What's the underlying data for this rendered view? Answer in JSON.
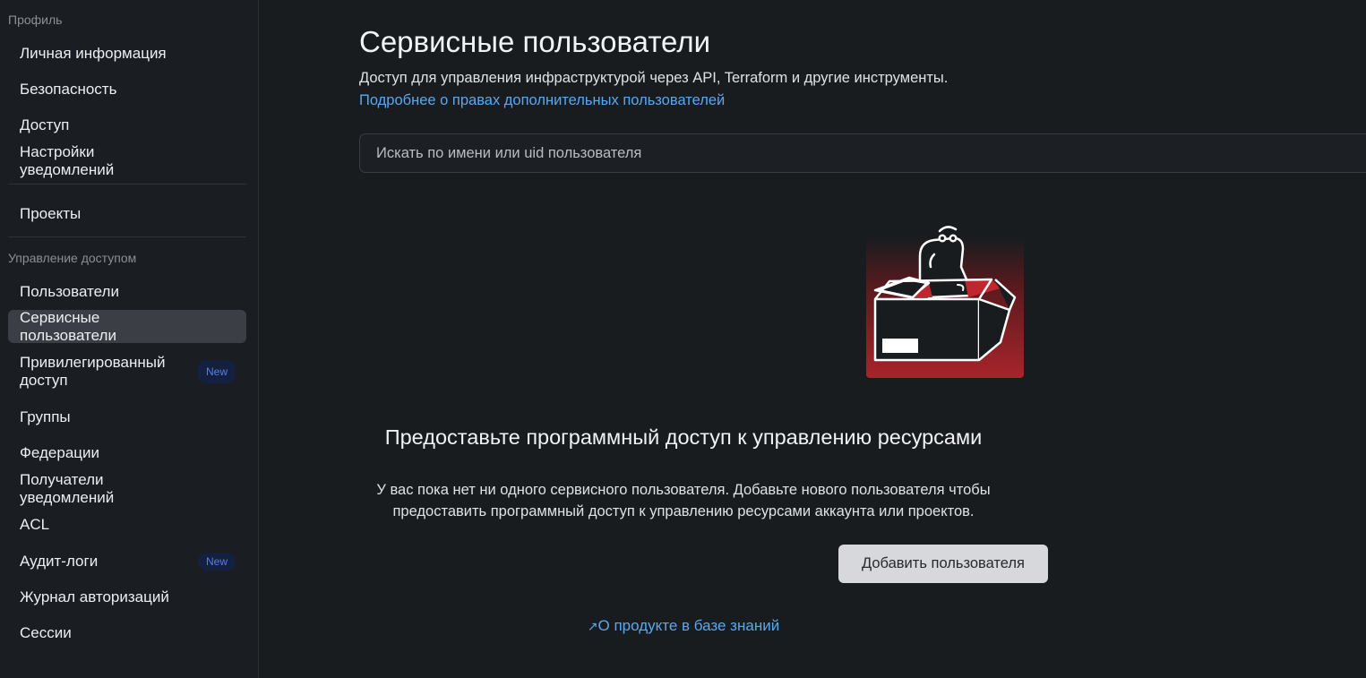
{
  "sidebar": {
    "section_profile": "Профиль",
    "profile_items": [
      {
        "label": "Личная информация"
      },
      {
        "label": "Безопасность"
      },
      {
        "label": "Доступ"
      },
      {
        "label": "Настройки уведомлений"
      }
    ],
    "projects": {
      "label": "Проекты"
    },
    "section_access": "Управление доступом",
    "access_items": [
      {
        "label": "Пользователи"
      },
      {
        "label": "Сервисные пользователи",
        "active": true
      },
      {
        "label": "Привилегированный доступ",
        "badge": "New"
      },
      {
        "label": "Группы"
      },
      {
        "label": "Федерации"
      },
      {
        "label": "Получатели уведомлений"
      },
      {
        "label": "ACL"
      },
      {
        "label": "Аудит-логи",
        "badge": "New"
      },
      {
        "label": "Журнал авторизаций"
      },
      {
        "label": "Сессии"
      }
    ]
  },
  "main": {
    "title": "Сервисные пользователи",
    "subtitle": "Доступ для управления инфраструктурой через API, Terraform и другие инструменты.",
    "more_link": "Подробнее о правах дополнительных пользователей",
    "search": {
      "placeholder": "Искать по имени или uid пользователя",
      "value": ""
    },
    "empty_state": {
      "title": "Предоставьте программный доступ к управлению ресурсами",
      "desc_line1": "У вас пока нет ни одного сервисного пользователя. Добавьте нового пользователя чтобы",
      "desc_line2": "предоставить программный доступ к управлению ресурсами аккаунта или проектов.",
      "button": "Добавить пользователя",
      "kb_arrow": "↗",
      "kb_link": "О продукте в базе знаний",
      "illustration_icon": "dinosaur-in-box-icon"
    }
  },
  "colors": {
    "background": "#191c1f",
    "link": "#5aa7f0",
    "active_item": "#3b3f45",
    "accent_red": "#c0262d"
  }
}
